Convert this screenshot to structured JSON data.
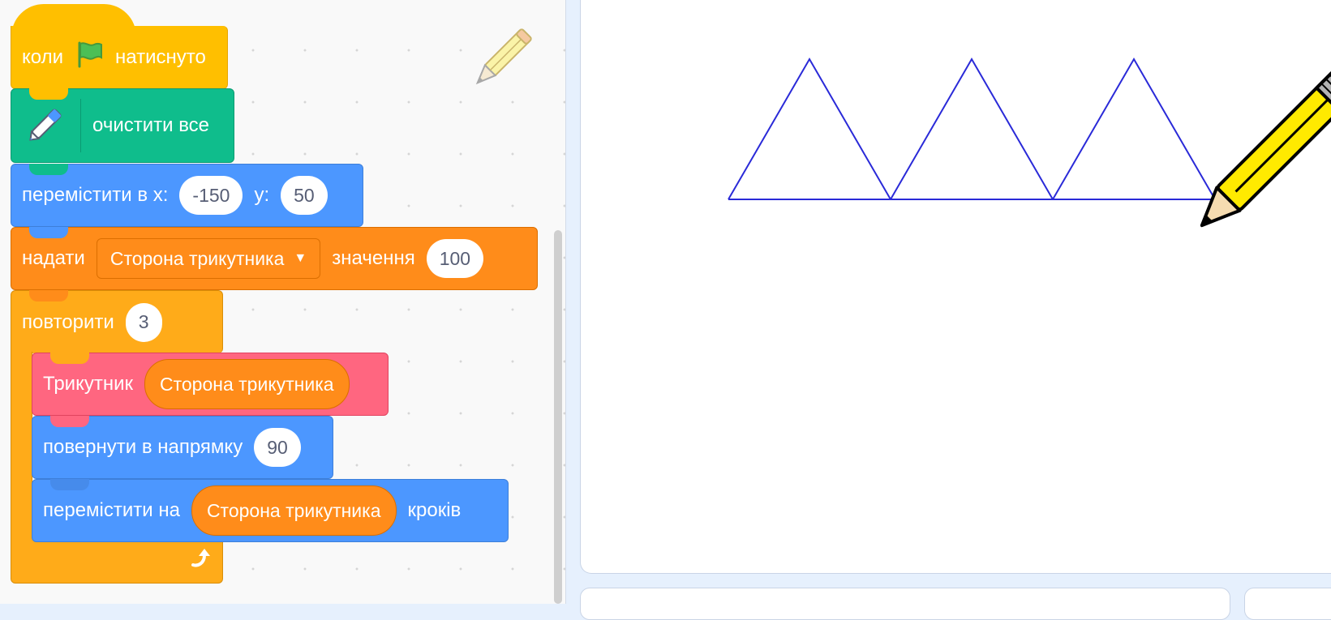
{
  "script": {
    "when_flag": {
      "text_before": "коли",
      "text_after": "натиснуто",
      "icon": "green-flag-icon"
    },
    "clear": {
      "label": "очистити все",
      "icon": "pen-extension-icon"
    },
    "goto": {
      "label": "перемістити в x:",
      "x": "-150",
      "y_label": "y:",
      "y": "50"
    },
    "set_var": {
      "label": "надати",
      "variable": "Сторона трикутника",
      "value_label": "значення",
      "value": "100"
    },
    "repeat": {
      "label": "повторити",
      "count": "3",
      "icon": "loop-arrow-icon"
    },
    "triangle_call": {
      "label": "Трикутник",
      "arg": "Сторона трикутника"
    },
    "point": {
      "label": "повернути в напрямку",
      "value": "90"
    },
    "move": {
      "label": "перемістити на",
      "arg": "Сторона трикутника",
      "suffix": "кроків"
    }
  },
  "colors": {
    "events": "#ffbf00",
    "pen": "#0fbd8c",
    "motion": "#4c97ff",
    "variables": "#ff8c1a",
    "control": "#ffab19",
    "custom": "#ff6680",
    "drawn_line": "#2a2ad8"
  },
  "stage": {
    "sprite_icon": "pencil-sprite-icon"
  }
}
